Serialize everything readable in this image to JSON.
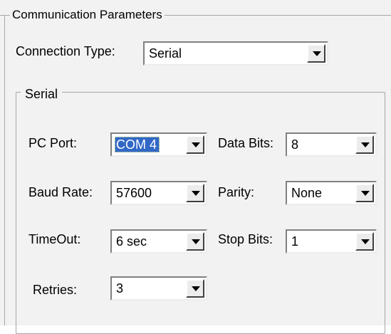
{
  "group": {
    "title": "Communication Parameters"
  },
  "connection": {
    "label": "Connection Type:",
    "value": "Serial"
  },
  "serial": {
    "title": "Serial",
    "pc_port": {
      "label": "PC Port:",
      "value": "COM 4"
    },
    "baud_rate": {
      "label": "Baud Rate:",
      "value": "57600"
    },
    "timeout": {
      "label": "TimeOut:",
      "value": "6 sec"
    },
    "retries": {
      "label": "Retries:",
      "value": "3"
    },
    "data_bits": {
      "label": "Data Bits:",
      "value": "8"
    },
    "parity": {
      "label": "Parity:",
      "value": "None"
    },
    "stop_bits": {
      "label": "Stop Bits:",
      "value": "1"
    }
  },
  "icons": {
    "dropdown": "chevron-down-icon"
  },
  "colors": {
    "selection": "#3168c6",
    "panel": "#f2f2f2",
    "border": "#a6a6a6"
  }
}
